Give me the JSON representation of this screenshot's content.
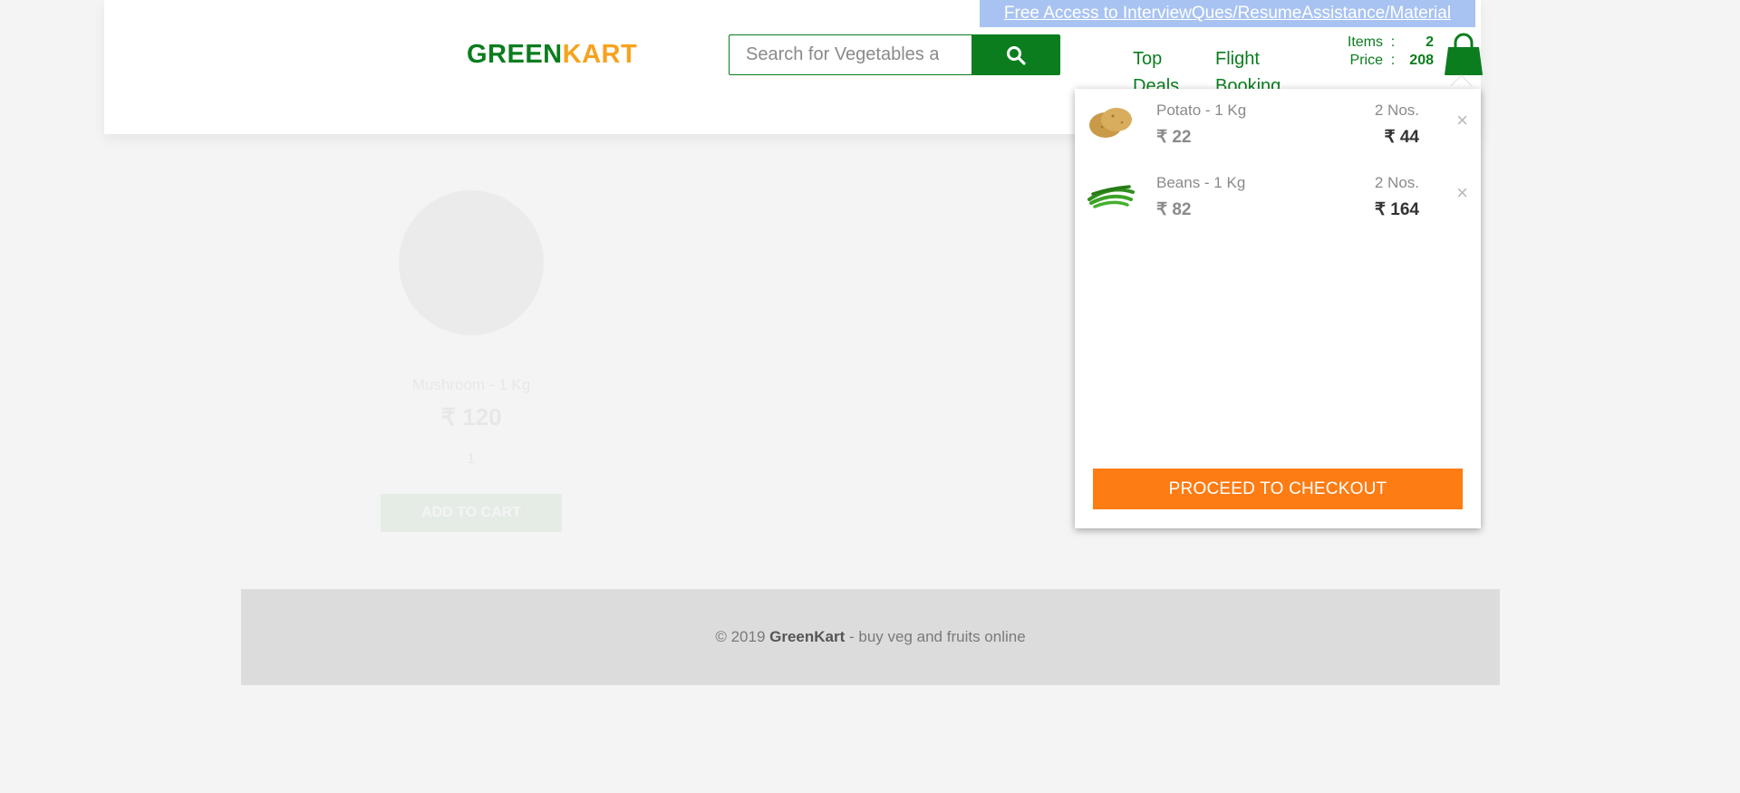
{
  "promo": {
    "label": "Free Access to InterviewQues/ResumeAssistance/Material"
  },
  "brand": {
    "part1": "GREEN",
    "part2": "KART"
  },
  "search": {
    "placeholder": "Search for Vegetables and Fruits",
    "icon": "search-icon"
  },
  "nav": {
    "top_deals": "Top Deals",
    "flight_booking": "Flight Booking"
  },
  "cart_summary": {
    "items_label": "Items",
    "items_value": "2",
    "price_label": "Price",
    "price_value": "208",
    "separator": ":"
  },
  "cart_preview": {
    "items": [
      {
        "name": "Potato - 1 Kg",
        "price": "₹ 22",
        "qty": "2 Nos.",
        "amount": "₹ 44",
        "remove": "×"
      },
      {
        "name": "Beans - 1 Kg",
        "price": "₹ 82",
        "qty": "2 Nos.",
        "amount": "₹ 164",
        "remove": "×"
      }
    ],
    "checkout_label": "PROCEED TO CHECKOUT"
  },
  "background_product": {
    "name": "Mushroom - 1 Kg",
    "price": "₹ 120",
    "quantity": "1",
    "add_label": "ADD TO CART"
  },
  "footer": {
    "prefix": "© 2019 ",
    "brand": "GreenKart",
    "suffix": " - buy veg and fruits online"
  },
  "colors": {
    "brand_green": "#0b7d1e",
    "brand_orange": "#f7a21d",
    "checkout_orange": "#fe7c14",
    "promo_bg": "#a8c3f2"
  }
}
